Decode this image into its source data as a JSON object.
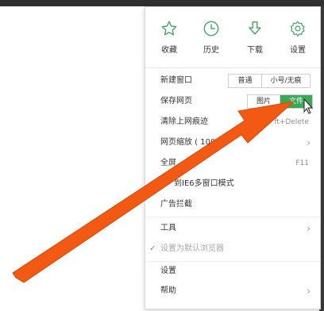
{
  "background": {
    "lines": [
      "",
      "",
      "",
      "",
      ""
    ]
  },
  "quick_actions": [
    {
      "icon": "star-icon",
      "label": "收藏"
    },
    {
      "icon": "clock-icon",
      "label": "历史"
    },
    {
      "icon": "download-icon",
      "label": "下载"
    },
    {
      "icon": "gear-icon",
      "label": "设置"
    }
  ],
  "menu": {
    "new_window": {
      "label": "新建窗口",
      "normal": "普通",
      "private": "小号/无痕"
    },
    "save_page": {
      "label": "保存网页",
      "image": "图片",
      "file": "文件"
    },
    "clear_traces": {
      "label": "清除上网痕迹",
      "shortcut": "ft+Delete"
    },
    "zoom": {
      "label": "网页缩放 ( 100"
    },
    "fullscreen": {
      "label": "全屏",
      "shortcut": "F11"
    },
    "ie6_mode": {
      "label": "到IE6多窗口模式"
    },
    "ad_block": {
      "label": "广告拦截"
    },
    "tools": {
      "label": "工具"
    },
    "set_default": {
      "label": "设置为默认浏览器"
    },
    "settings": {
      "label": "设置"
    },
    "help": {
      "label": "帮助"
    }
  },
  "colors": {
    "accent": "#3aa856",
    "icon_green": "#4aa86b",
    "arrow": "#f25a14"
  }
}
